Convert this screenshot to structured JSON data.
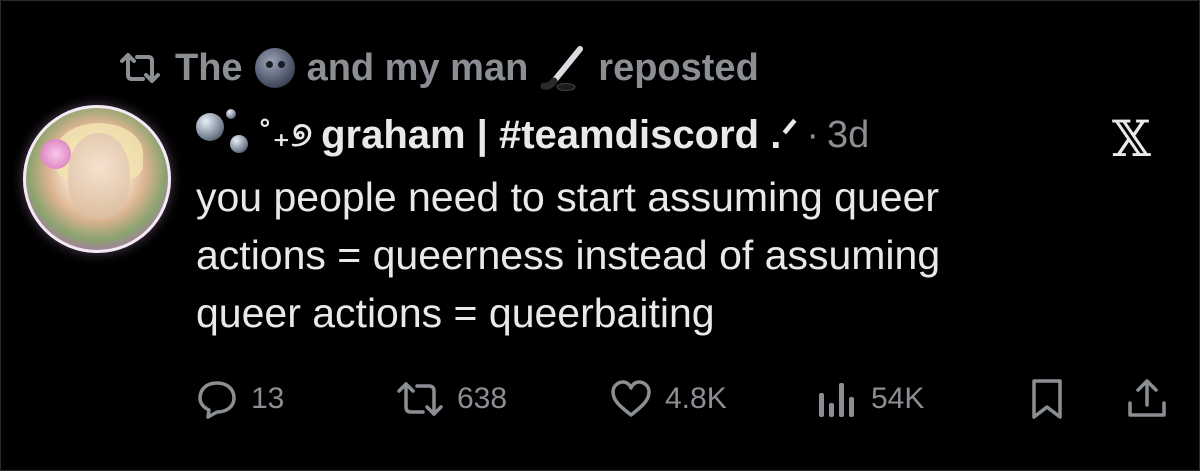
{
  "repost": {
    "prefix": "The",
    "middle": "and my man",
    "suffix": "reposted",
    "icons": [
      "repost-icon",
      "new-moon-face-emoji",
      "hockey-stick-emoji"
    ]
  },
  "tweet": {
    "author_decor": "˚₊୭",
    "author_name": "graham | #teamdiscord .ᐟ",
    "separator": "·",
    "time": "3d",
    "text": "you people need to start assuming queer\nactions = queerness instead of assuming\nqueer actions = queerbaiting"
  },
  "header": {
    "close_glyph": "𝕏"
  },
  "actions": {
    "replies": "13",
    "reposts": "638",
    "likes": "4.8K",
    "views": "54K"
  },
  "colors": {
    "background": "#000000",
    "primary_text": "#e7e9ea",
    "secondary_text": "#8b8f94"
  }
}
